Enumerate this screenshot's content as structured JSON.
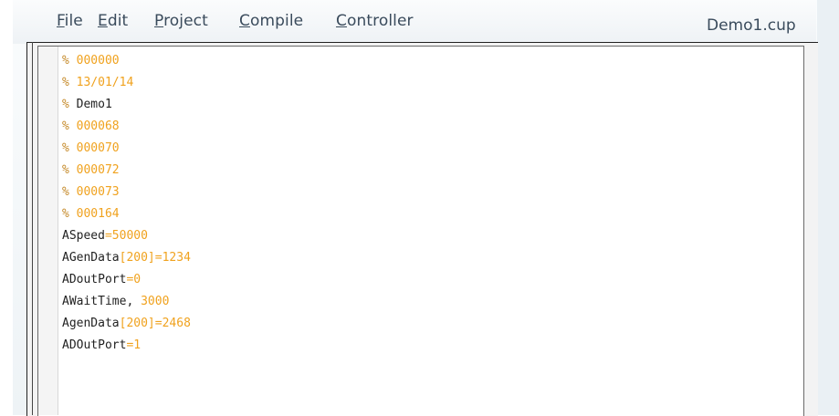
{
  "menu": {
    "items": [
      {
        "underline": "F",
        "rest": "ile"
      },
      {
        "underline": "E",
        "rest": "dit"
      },
      {
        "underline": "P",
        "rest": "roject"
      },
      {
        "underline": "C",
        "rest": "ompile"
      },
      {
        "underline": "C",
        "rest": "ontroller"
      }
    ]
  },
  "document": {
    "name": "Demo1.cup"
  },
  "code_lines": [
    {
      "parts": [
        {
          "t": "%",
          "c": "pct"
        },
        {
          "t": " 000000",
          "c": "cmt"
        }
      ]
    },
    {
      "parts": [
        {
          "t": "%",
          "c": "pct"
        },
        {
          "t": " 13/01/14",
          "c": "cmt"
        }
      ]
    },
    {
      "parts": [
        {
          "t": "%",
          "c": "pct"
        },
        {
          "t": " Demo1",
          "c": "txt"
        }
      ]
    },
    {
      "parts": [
        {
          "t": "%",
          "c": "pct"
        },
        {
          "t": " 000068",
          "c": "cmt"
        }
      ]
    },
    {
      "parts": [
        {
          "t": "%",
          "c": "pct"
        },
        {
          "t": " 000070",
          "c": "cmt"
        }
      ]
    },
    {
      "parts": [
        {
          "t": "%",
          "c": "pct"
        },
        {
          "t": " 000072",
          "c": "cmt"
        }
      ]
    },
    {
      "parts": [
        {
          "t": "%",
          "c": "pct"
        },
        {
          "t": " 000073",
          "c": "cmt"
        }
      ]
    },
    {
      "parts": [
        {
          "t": "%",
          "c": "pct"
        },
        {
          "t": " 000164",
          "c": "cmt"
        }
      ]
    },
    {
      "parts": [
        {
          "t": "ASpeed",
          "c": "txt"
        },
        {
          "t": "=50000",
          "c": "num"
        }
      ]
    },
    {
      "parts": [
        {
          "t": "AGenData",
          "c": "txt"
        },
        {
          "t": "[200]=1234",
          "c": "num"
        }
      ]
    },
    {
      "parts": [
        {
          "t": "ADoutPort",
          "c": "txt"
        },
        {
          "t": "=0",
          "c": "num"
        }
      ]
    },
    {
      "parts": [
        {
          "t": "AWaitTime,",
          "c": "txt"
        },
        {
          "t": " 3000",
          "c": "num"
        }
      ]
    },
    {
      "parts": [
        {
          "t": "AgenData",
          "c": "txt"
        },
        {
          "t": "[200]=2468",
          "c": "num"
        }
      ]
    },
    {
      "parts": [
        {
          "t": "ADOutPort",
          "c": "txt"
        },
        {
          "t": "=1",
          "c": "num"
        }
      ]
    }
  ],
  "colors": {
    "comment": "#f0a21e",
    "percent": "#c58a2a",
    "text": "#222222",
    "menu_text": "#3a4b5c"
  }
}
